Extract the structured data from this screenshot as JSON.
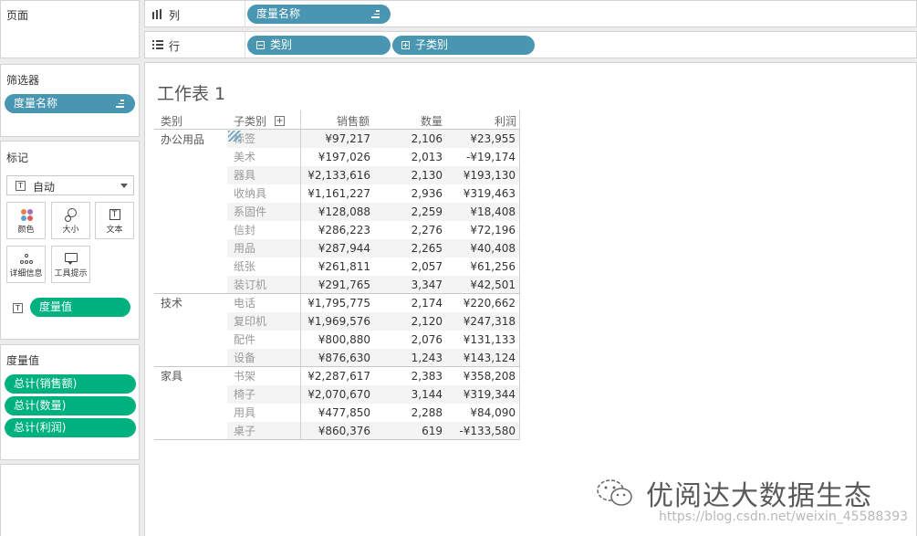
{
  "pages": {
    "title": "页面"
  },
  "shelves": {
    "columns": {
      "label": "列",
      "pill": "度量名称"
    },
    "rows": {
      "label": "行",
      "pills": [
        "类别",
        "子类别"
      ]
    }
  },
  "filters": {
    "title": "筛选器",
    "pill": "度量名称"
  },
  "marks": {
    "title": "标记",
    "type": "自动",
    "buttons": {
      "color": "颜色",
      "size": "大小",
      "text": "文本",
      "detail": "详细信息",
      "tooltip": "工具提示"
    },
    "text_pill": "度量值"
  },
  "measure_values": {
    "title": "度量值",
    "pills": [
      "总计(销售额)",
      "总计(数量)",
      "总计(利润)"
    ]
  },
  "worksheet": {
    "title": "工作表 1",
    "headers": {
      "category": "类别",
      "subcategory": "子类别",
      "sales": "销售额",
      "quantity": "数量",
      "profit": "利润"
    },
    "categories": [
      "办公用品",
      "技术",
      "家具"
    ],
    "rows": [
      {
        "sub": "标签",
        "sales": "¥97,217",
        "qty": "2,106",
        "profit": "¥23,955"
      },
      {
        "sub": "美术",
        "sales": "¥197,026",
        "qty": "2,013",
        "profit": "-¥19,174"
      },
      {
        "sub": "器具",
        "sales": "¥2,133,616",
        "qty": "2,130",
        "profit": "¥193,130"
      },
      {
        "sub": "收纳具",
        "sales": "¥1,161,227",
        "qty": "2,936",
        "profit": "¥319,463"
      },
      {
        "sub": "系固件",
        "sales": "¥128,088",
        "qty": "2,259",
        "profit": "¥18,408"
      },
      {
        "sub": "信封",
        "sales": "¥286,223",
        "qty": "2,276",
        "profit": "¥72,196"
      },
      {
        "sub": "用品",
        "sales": "¥287,944",
        "qty": "2,265",
        "profit": "¥40,408"
      },
      {
        "sub": "纸张",
        "sales": "¥261,811",
        "qty": "2,057",
        "profit": "¥61,256"
      },
      {
        "sub": "装订机",
        "sales": "¥291,765",
        "qty": "3,347",
        "profit": "¥42,501"
      },
      {
        "sub": "电话",
        "sales": "¥1,795,775",
        "qty": "2,174",
        "profit": "¥220,662"
      },
      {
        "sub": "复印机",
        "sales": "¥1,969,576",
        "qty": "2,120",
        "profit": "¥247,318"
      },
      {
        "sub": "配件",
        "sales": "¥800,880",
        "qty": "2,076",
        "profit": "¥131,133"
      },
      {
        "sub": "设备",
        "sales": "¥876,630",
        "qty": "1,243",
        "profit": "¥143,124"
      },
      {
        "sub": "书架",
        "sales": "¥2,287,617",
        "qty": "2,383",
        "profit": "¥358,208"
      },
      {
        "sub": "椅子",
        "sales": "¥2,070,670",
        "qty": "3,144",
        "profit": "¥319,344"
      },
      {
        "sub": "用具",
        "sales": "¥477,850",
        "qty": "2,288",
        "profit": "¥84,090"
      },
      {
        "sub": "桌子",
        "sales": "¥860,376",
        "qty": "619",
        "profit": "-¥133,580"
      }
    ]
  },
  "watermark": {
    "brand": "优阅达大数据生态",
    "url": "https://blog.csdn.net/weixin_45588393"
  },
  "colors": {
    "dimension_pill": "#4996b2",
    "measure_pill": "#00b180"
  }
}
